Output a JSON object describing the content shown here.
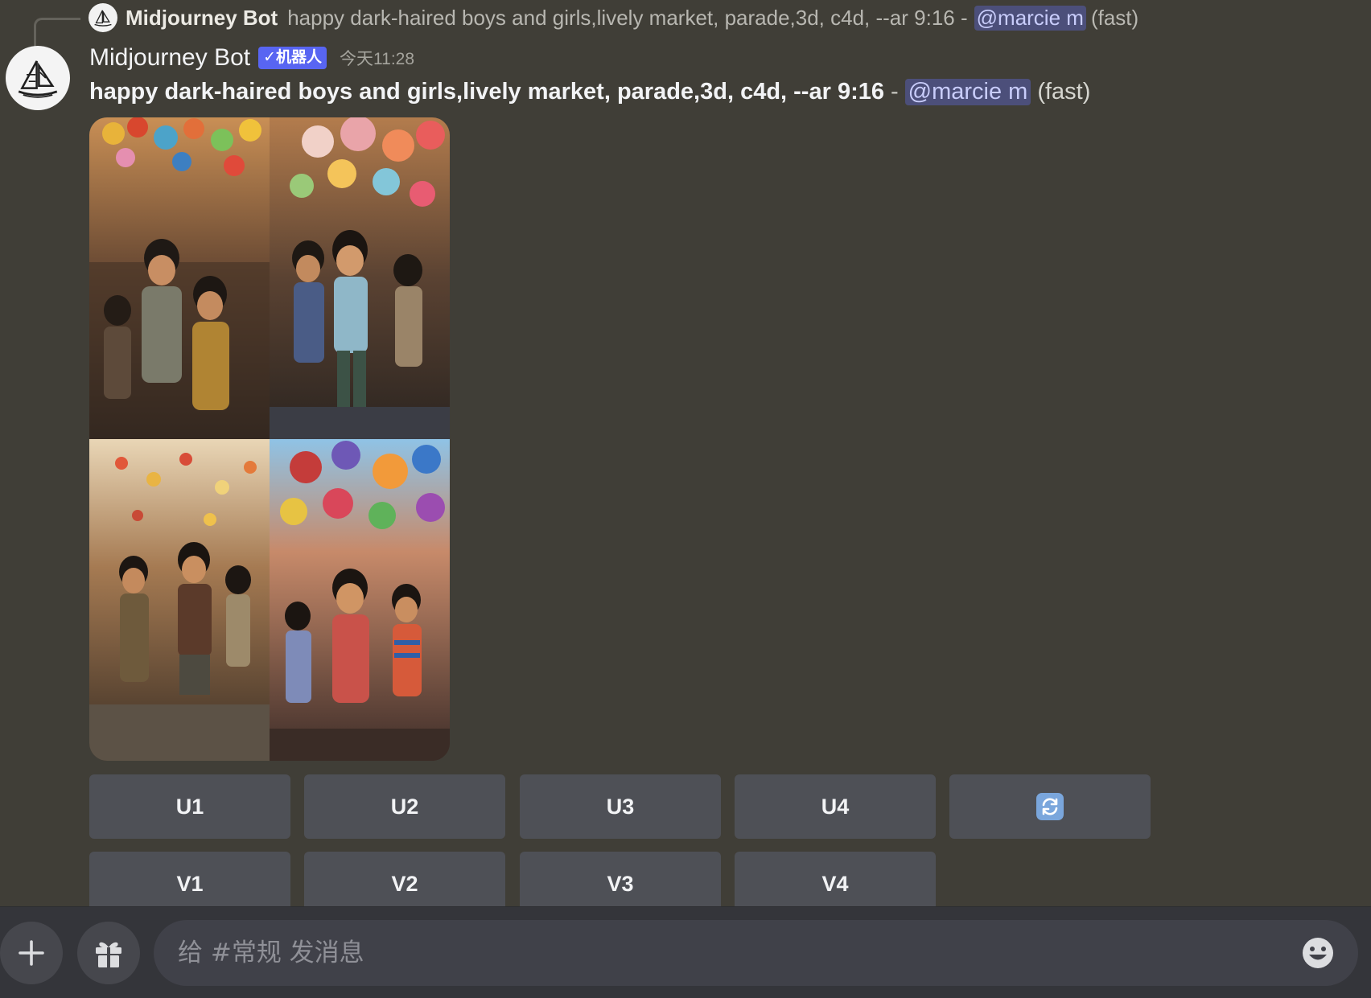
{
  "reply": {
    "author": "Midjourney Bot",
    "text": "happy dark-haired boys and girls,lively market, parade,3d, c4d, --ar 9:16 -",
    "mention": "@marcie m",
    "suffix": "(fast)"
  },
  "message": {
    "author": "Midjourney Bot",
    "bot_tag": "✓机器人",
    "timestamp": "今天11:28",
    "prompt": "happy dark-haired boys and girls,lively market, parade,3d, c4d, --ar 9:16",
    "separator": "-",
    "mention": "@marcie m",
    "suffix": "(fast)"
  },
  "buttons": {
    "upscale": [
      "U1",
      "U2",
      "U3",
      "U4"
    ],
    "variation": [
      "V1",
      "V2",
      "V3",
      "V4"
    ],
    "reroll_icon": "refresh-icon"
  },
  "composer": {
    "placeholder": "给 #常规 发消息",
    "add_icon": "plus-icon",
    "gift_icon": "gift-icon",
    "emoji_icon": "emoji-icon"
  },
  "colors": {
    "background": "#403e37",
    "button": "#4e5056",
    "mention_bg": "#4c4f7a",
    "bot_tag": "#5865f2"
  }
}
